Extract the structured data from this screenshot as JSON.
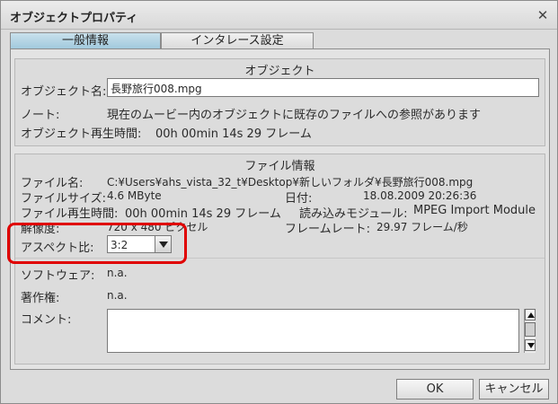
{
  "window": {
    "title": "オブジェクトプロパティ",
    "close_glyph": "✕"
  },
  "tabs": [
    {
      "label": "一般情報",
      "active": true
    },
    {
      "label": "インタレース設定",
      "active": false
    }
  ],
  "object_group": {
    "title": "オブジェクト",
    "name_label": "オブジェクト名:",
    "name_value": "長野旅行008.mpg",
    "note_label": "ノート:",
    "note_value": "現在のムービー内のオブジェクトに既存のファイルへの参照があります",
    "duration_label": "オブジェクト再生時間:",
    "duration_value": "00h 00min 14s 29 フレーム"
  },
  "file_group": {
    "title": "ファイル情報",
    "filename_label": "ファイル名:",
    "filename_value": "C:¥Users¥ahs_vista_32_t¥Desktop¥新しいフォルダ¥長野旅行008.mpg",
    "filesize_label": "ファイルサイズ:",
    "filesize_value": "4.6 MByte",
    "date_label": "日付:",
    "date_value": "18.08.2009 20:26:36",
    "playtime_label": "ファイル再生時間:",
    "playtime_value": "00h 00min 14s 29 フレーム",
    "module_label": "読み込みモジュール:",
    "module_value": "MPEG Import Module",
    "resolution_label": "解像度:",
    "resolution_value": "720 x 480 ピクセル",
    "framerate_label": "フレームレート:",
    "framerate_value": "29.97 フレーム/秒",
    "aspect_label": "アスペクト比:",
    "aspect_value": "3:2",
    "software_label": "ソフトウェア:",
    "software_value": "n.a.",
    "copyright_label": "著作権:",
    "copyright_value": "n.a.",
    "comment_label": "コメント:",
    "comment_value": ""
  },
  "buttons": {
    "ok": "OK",
    "cancel": "キャンセル"
  },
  "colors": {
    "highlight": "#e00000",
    "active_tab": "#9fc8dc"
  }
}
